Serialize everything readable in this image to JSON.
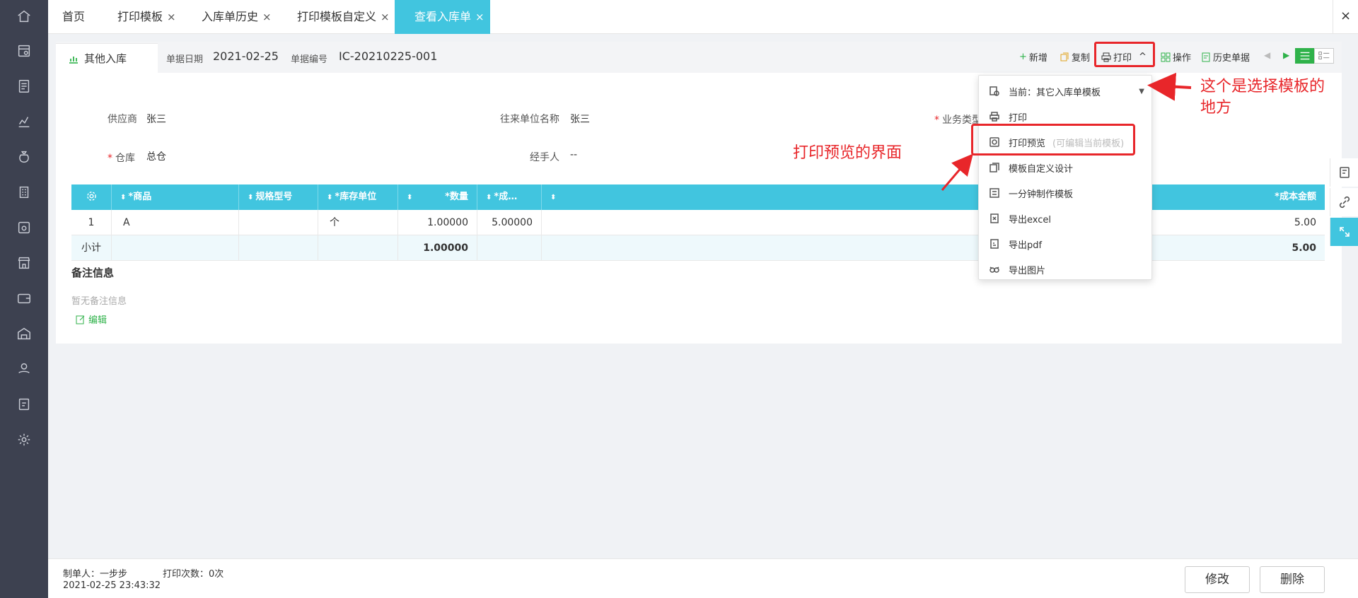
{
  "tabs": [
    {
      "label": "首页",
      "closable": false
    },
    {
      "label": "打印模板",
      "closable": true
    },
    {
      "label": "入库单历史",
      "closable": true
    },
    {
      "label": "打印模板自定义",
      "closable": true
    },
    {
      "label": "查看入库单",
      "closable": true,
      "active": true
    }
  ],
  "tab_close_glyph": "×",
  "window_close": "×",
  "doc": {
    "tab_label": "其他入库",
    "date_label": "单据日期",
    "date_value": "2021-02-25",
    "no_label": "单据编号",
    "no_value": "IC-20210225-001"
  },
  "toolbar": {
    "new": "新增",
    "copy": "复制",
    "print": "打印",
    "action": "操作",
    "history": "历史单据"
  },
  "fields": {
    "supplier_label": "供应商",
    "supplier_value": "张三",
    "partner_label": "往来单位名称",
    "partner_value": "张三",
    "biz_type_label": "业务类型",
    "warehouse_label": "仓库",
    "warehouse_value": "总仓",
    "handler_label": "经手人",
    "handler_value": "--"
  },
  "table": {
    "headers": {
      "product": "商品",
      "spec": "规格型号",
      "unit": "库存单位",
      "qty": "数量",
      "cost": "成…",
      "amount": "成本金额"
    },
    "rows": [
      {
        "index": "1",
        "product": "A",
        "spec": "",
        "unit": "个",
        "qty": "1.00000",
        "cost": "5.00000",
        "amount": "5.00"
      }
    ],
    "subtotal": {
      "label": "小计",
      "qty": "1.00000",
      "amount": "5.00"
    }
  },
  "notes": {
    "title": "备注信息",
    "empty": "暂无备注信息",
    "edit": "编辑"
  },
  "dropdown": {
    "current_label": "当前：其它入库单模板",
    "items": [
      {
        "label": "打印",
        "icon": "printer-icon"
      },
      {
        "label": "打印预览",
        "hint": "(可编辑当前模板)",
        "icon": "preview-icon"
      },
      {
        "label": "模板自定义设计",
        "icon": "copy-icon"
      },
      {
        "label": "一分钟制作模板",
        "icon": "template-icon"
      },
      {
        "label": "导出excel",
        "icon": "excel-icon"
      },
      {
        "label": "导出pdf",
        "icon": "pdf-icon"
      },
      {
        "label": "导出图片",
        "icon": "image-icon"
      }
    ]
  },
  "annotations": {
    "template_select": "这个是选择模板的\n地方",
    "preview": "打印预览的界面"
  },
  "footer": {
    "creator": "制单人：一步步",
    "print_count": "打印次数：0次",
    "created_at": "2021-02-25 23:43:32",
    "modify": "修改",
    "delete": "删除"
  },
  "colors": {
    "accent": "#41c5df",
    "annotation": "#e8262a",
    "rail": "#3d4150",
    "link_green": "#2fb24a"
  }
}
